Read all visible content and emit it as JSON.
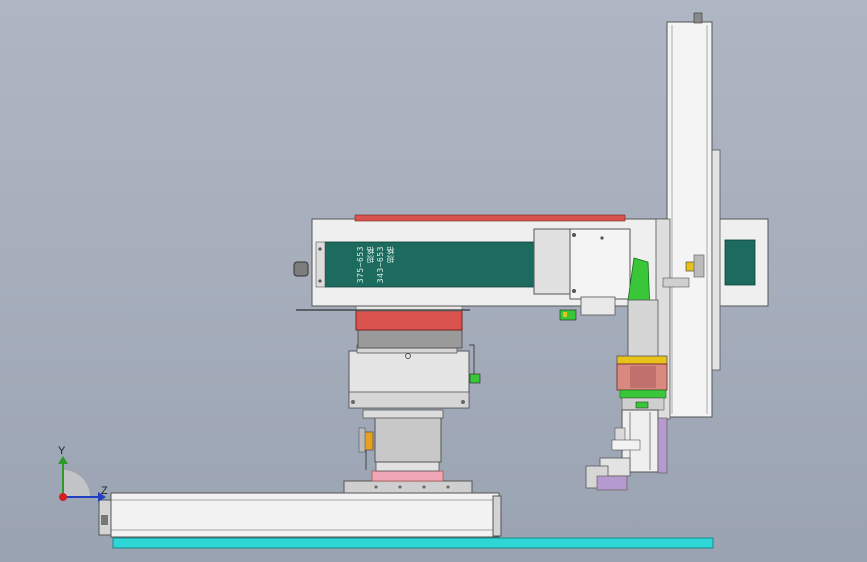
{
  "part_labels": {
    "line1": "规格",
    "line2": "343~653",
    "line3": "规格",
    "line4": "375~653"
  },
  "triad": {
    "y_label": "Y",
    "z_label": "Z"
  },
  "colors": {
    "background": "#a9b1bf",
    "panel_teal": "#1d6b5e",
    "base_cyan": "#2fd6d6",
    "red_plate": "#d9534f",
    "salmon_block": "#d98a80",
    "green_bracket": "#39c739",
    "pink_plate": "#f0a6b6",
    "purple_plate": "#b59ad0",
    "yellow_accent": "#e6c21a",
    "orange_accent": "#e8a020"
  }
}
